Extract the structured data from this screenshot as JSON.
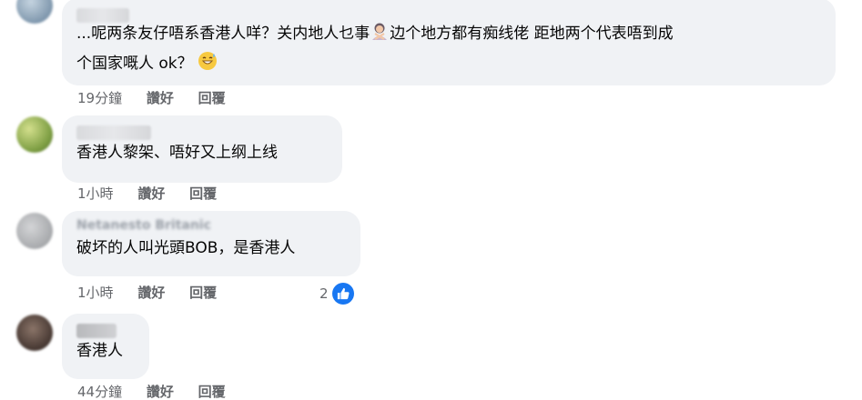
{
  "comments": [
    {
      "author": "",
      "text_line1": "...呢两条友仔唔系香港人咩？关内地人乜事",
      "text_line1b": "边个地方都有痴线佬 距地两个代表唔到成",
      "text_line2": "个国家嘅人 ok？",
      "time": "19分鐘",
      "like": "讚好",
      "reply": "回覆",
      "avatar_color": "#8aa3b8"
    },
    {
      "author": "",
      "text": "香港人黎架、唔好又上纲上线",
      "time": "1小時",
      "like": "讚好",
      "reply": "回覆",
      "avatar_color": "#8fae5c"
    },
    {
      "author": "Netanesto Britanic",
      "text": "破坏的人叫光頭BOB，是香港人",
      "time": "1小時",
      "like": "讚好",
      "reply": "回覆",
      "reaction_count": "2",
      "avatar_color": "#b9bbbe"
    },
    {
      "author": "",
      "text": "香港人",
      "time": "44分鐘",
      "like": "讚好",
      "reply": "回覆",
      "avatar_color": "#5a4a44"
    }
  ],
  "icons": {
    "like_reaction": "thumbs-up-icon",
    "emoji_person": "person-gesturing-no-icon",
    "emoji_smile": "grinning-sweat-icon"
  },
  "colors": {
    "bubble": "#f0f2f5",
    "meta_text": "#65676b",
    "like_blue": "#1877f2"
  }
}
